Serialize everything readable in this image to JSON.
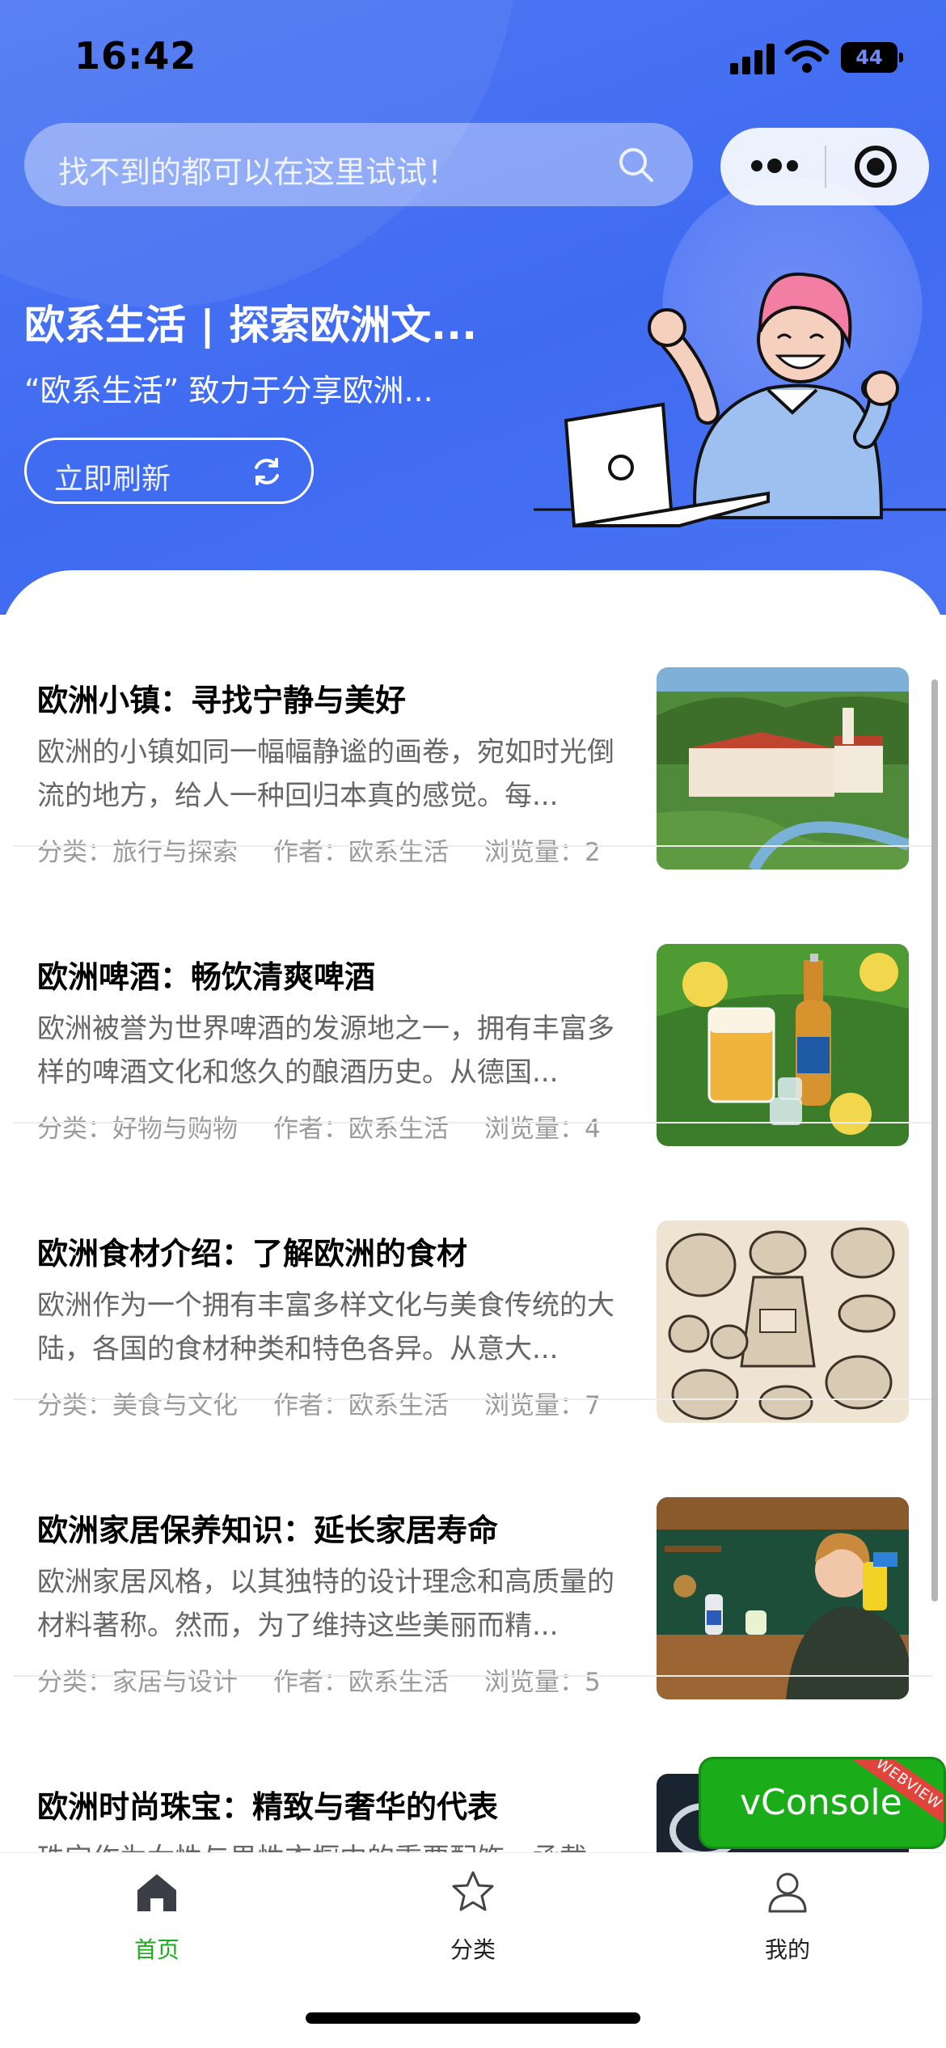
{
  "status": {
    "time": "16:42",
    "battery": "44"
  },
  "search": {
    "placeholder": "找不到的都可以在这里试试！"
  },
  "hero": {
    "title": "欧系生活 | 探索欧洲文...",
    "subtitle": "“欧系生活” 致力于分享欧洲...",
    "refresh_label": "立即刷新"
  },
  "articles": [
    {
      "title": "欧洲小镇：寻找宁静与美好",
      "desc": "欧洲的小镇如同一幅幅静谧的画卷，宛如时光倒流的地方，给人一种回归本真的感觉。每...",
      "category": "分类：旅行与探索",
      "author": "作者：欧系生活",
      "views": "浏览量：2",
      "thumb": "town-landscape-image"
    },
    {
      "title": "欧洲啤酒：畅饮清爽啤酒",
      "desc": "欧洲被誉为世界啤酒的发源地之一，拥有丰富多样的啤酒文化和悠久的酿酒历史。从德国...",
      "category": "分类：好物与购物",
      "author": "作者：欧系生活",
      "views": "浏览量：4",
      "thumb": "beer-image"
    },
    {
      "title": "欧洲食材介绍：了解欧洲的食材",
      "desc": "欧洲作为一个拥有丰富多样文化与美食传统的大陆，各国的食材种类和特色各异。从意大...",
      "category": "分类：美食与文化",
      "author": "作者：欧系生活",
      "views": "浏览量：7",
      "thumb": "ingredients-sketch-image"
    },
    {
      "title": "欧洲家居保养知识：延长家居寿命",
      "desc": "欧洲家居风格，以其独特的设计理念和高质量的材料著称。然而，为了维持这些美丽而精...",
      "category": "分类：家居与设计",
      "author": "作者：欧系生活",
      "views": "浏览量：5",
      "thumb": "home-cleaning-image"
    },
    {
      "title": "欧洲时尚珠宝：精致与奢华的代表",
      "desc": "珠宝作为女性与男性衣橱中的重要配饰，承载",
      "category": "",
      "author": "",
      "views": "",
      "thumb": "jewelry-image"
    }
  ],
  "vconsole": {
    "label": "vConsole",
    "ribbon": "WEBVIEW"
  },
  "tabbar": [
    {
      "label": "首页",
      "icon": "home-icon",
      "active": true
    },
    {
      "label": "分类",
      "icon": "star-icon",
      "active": false
    },
    {
      "label": "我的",
      "icon": "user-icon",
      "active": false
    }
  ],
  "colors": {
    "primary": "#4570f2",
    "active_tab": "#1aad19",
    "vconsole": "#1aad19"
  }
}
